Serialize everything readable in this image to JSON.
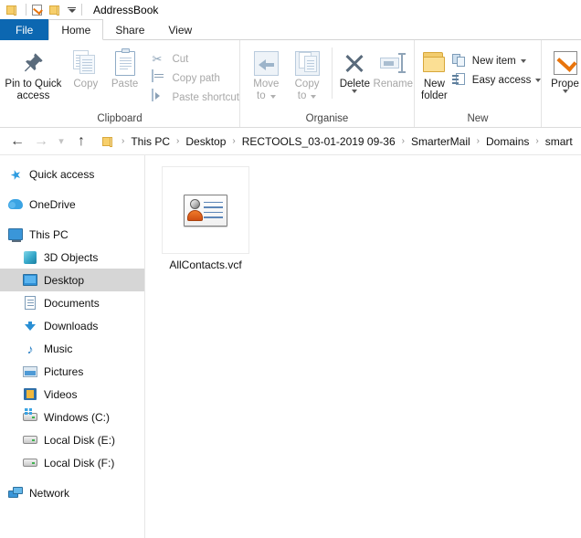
{
  "window": {
    "title": "AddressBook",
    "quick_access_icons": [
      "folder-icon",
      "properties-icon",
      "new-folder-icon",
      "customize-qat-caret"
    ]
  },
  "tabs": [
    {
      "label": "File",
      "active": false,
      "style": "file"
    },
    {
      "label": "Home",
      "active": true,
      "style": "normal"
    },
    {
      "label": "Share",
      "active": false,
      "style": "normal"
    },
    {
      "label": "View",
      "active": false,
      "style": "normal"
    }
  ],
  "ribbon": {
    "groups": [
      {
        "title": "Clipboard",
        "large_buttons": [
          {
            "label_line1": "Pin to Quick",
            "label_line2": "access",
            "icon": "pin-icon",
            "disabled": false
          },
          {
            "label_line1": "Copy",
            "label_line2": "",
            "icon": "copy-icon",
            "disabled": true
          },
          {
            "label_line1": "Paste",
            "label_line2": "",
            "icon": "paste-icon",
            "disabled": true
          }
        ],
        "small_buttons": [
          {
            "label": "Cut",
            "icon": "scissors-icon",
            "disabled": true
          },
          {
            "label": "Copy path",
            "icon": "copy-path-icon",
            "disabled": true
          },
          {
            "label": "Paste shortcut",
            "icon": "paste-shortcut-icon",
            "disabled": true
          }
        ]
      },
      {
        "title": "Organise",
        "large_buttons": [
          {
            "label_line1": "Move",
            "label_line2": "to",
            "icon": "move-to-icon",
            "disabled": true,
            "caret": true
          },
          {
            "label_line1": "Copy",
            "label_line2": "to",
            "icon": "copy-to-icon",
            "disabled": true,
            "caret": true
          },
          {
            "label_line1": "Delete",
            "label_line2": "",
            "icon": "delete-icon",
            "disabled": false,
            "caret": true
          },
          {
            "label_line1": "Rename",
            "label_line2": "",
            "icon": "rename-icon",
            "disabled": true,
            "caret": false
          }
        ]
      },
      {
        "title": "New",
        "large_buttons": [
          {
            "label_line1": "New",
            "label_line2": "folder",
            "icon": "new-folder-icon",
            "disabled": false
          }
        ],
        "small_buttons": [
          {
            "label": "New item",
            "icon": "new-item-icon",
            "disabled": false,
            "caret": true
          },
          {
            "label": "Easy access",
            "icon": "easy-access-icon",
            "disabled": false,
            "caret": true
          }
        ]
      },
      {
        "title": "",
        "large_buttons": [
          {
            "label_line1": "Prope",
            "label_line2": "",
            "icon": "properties-icon",
            "disabled": false,
            "caret": true
          }
        ]
      }
    ]
  },
  "addressbar": {
    "back_icon": "back-arrow-icon",
    "forward_icon": "forward-arrow-icon",
    "recent_icon": "recent-locations-caret-icon",
    "up_icon": "up-arrow-icon",
    "path_icon": "folder-icon",
    "crumbs": [
      "This PC",
      "Desktop",
      "RECTOOLS_03-01-2019 09-36",
      "SmarterMail",
      "Domains",
      "smart"
    ],
    "separator": "›"
  },
  "navpane": {
    "items": [
      {
        "label": "Quick access",
        "icon": "star-icon",
        "indent": false,
        "selected": false
      },
      {
        "label": "OneDrive",
        "icon": "cloud-icon",
        "indent": false,
        "selected": false,
        "gap_before": true
      },
      {
        "label": "This PC",
        "icon": "monitor-icon",
        "indent": false,
        "selected": false,
        "gap_before": true
      },
      {
        "label": "3D Objects",
        "icon": "cube-icon",
        "indent": true,
        "selected": false
      },
      {
        "label": "Desktop",
        "icon": "desktop-icon",
        "indent": true,
        "selected": true
      },
      {
        "label": "Documents",
        "icon": "document-icon",
        "indent": true,
        "selected": false
      },
      {
        "label": "Downloads",
        "icon": "download-arrow-icon",
        "indent": true,
        "selected": false
      },
      {
        "label": "Music",
        "icon": "music-note-icon",
        "indent": true,
        "selected": false
      },
      {
        "label": "Pictures",
        "icon": "picture-icon",
        "indent": true,
        "selected": false
      },
      {
        "label": "Videos",
        "icon": "video-icon",
        "indent": true,
        "selected": false
      },
      {
        "label": "Windows (C:)",
        "icon": "windows-drive-icon",
        "indent": true,
        "selected": false
      },
      {
        "label": "Local Disk (E:)",
        "icon": "drive-icon",
        "indent": true,
        "selected": false
      },
      {
        "label": "Local Disk (F:)",
        "icon": "drive-icon",
        "indent": true,
        "selected": false
      },
      {
        "label": "Network",
        "icon": "network-icon",
        "indent": false,
        "selected": false,
        "gap_before": true
      }
    ]
  },
  "content": {
    "files": [
      {
        "name": "AllContacts.vcf",
        "icon": "vcard-contact-icon"
      }
    ]
  },
  "colors": {
    "file_tab_blue": "#0c67b1",
    "selection_gray": "#d6d6d6",
    "accent_orange": "#e8740c",
    "folder_yellow": "#f7cf6b"
  }
}
